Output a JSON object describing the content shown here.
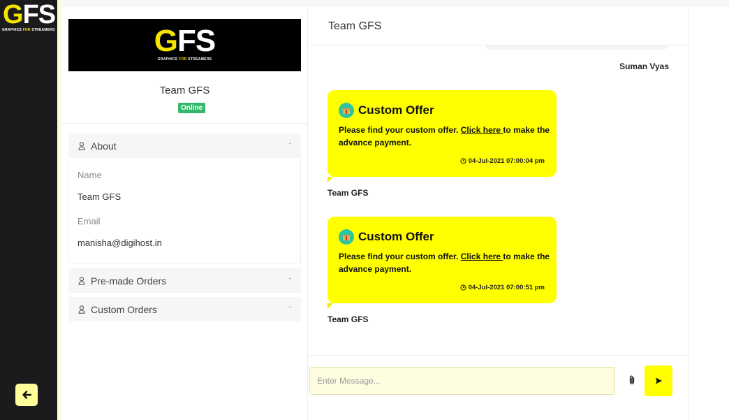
{
  "brand": {
    "logo_text_g": "G",
    "logo_text_fs": "FS",
    "tagline_a": "GRAPHICS ",
    "tagline_b": "FOR",
    "tagline_c": " STREAMERS"
  },
  "profile": {
    "name": "Team GFS",
    "status": "Online",
    "about_label": "About",
    "name_label": "Name",
    "name_value": "Team GFS",
    "email_label": "Email",
    "email_value": "manisha@digihost.in",
    "premade_label": "Pre-made Orders",
    "custom_label": "Custom Orders"
  },
  "chat": {
    "title": "Team GFS",
    "top_sender": "Suman Vyas",
    "messages": [
      {
        "title": "Custom Offer",
        "text_before": "Please find your custom offer. ",
        "link": "Click here ",
        "text_after": "to make the advance payment.",
        "time": "04-Jul-2021 07:00:04 pm",
        "sender": "Team GFS"
      },
      {
        "title": "Custom Offer",
        "text_before": "Please find your custom offer. ",
        "link": "Click here ",
        "text_after": "to make the advance payment.",
        "time": "04-Jul-2021 07:00:51 pm",
        "sender": "Team GFS"
      }
    ],
    "input_placeholder": "Enter Message..."
  },
  "colors": {
    "accent_yellow": "#ffff00",
    "rail_dark": "#1b1b1d",
    "online_green": "#34b86a"
  },
  "icons": [
    "back-arrow-icon",
    "user-icon",
    "chevron-up-icon",
    "gift-icon",
    "clock-icon",
    "paperclip-icon",
    "send-icon"
  ]
}
